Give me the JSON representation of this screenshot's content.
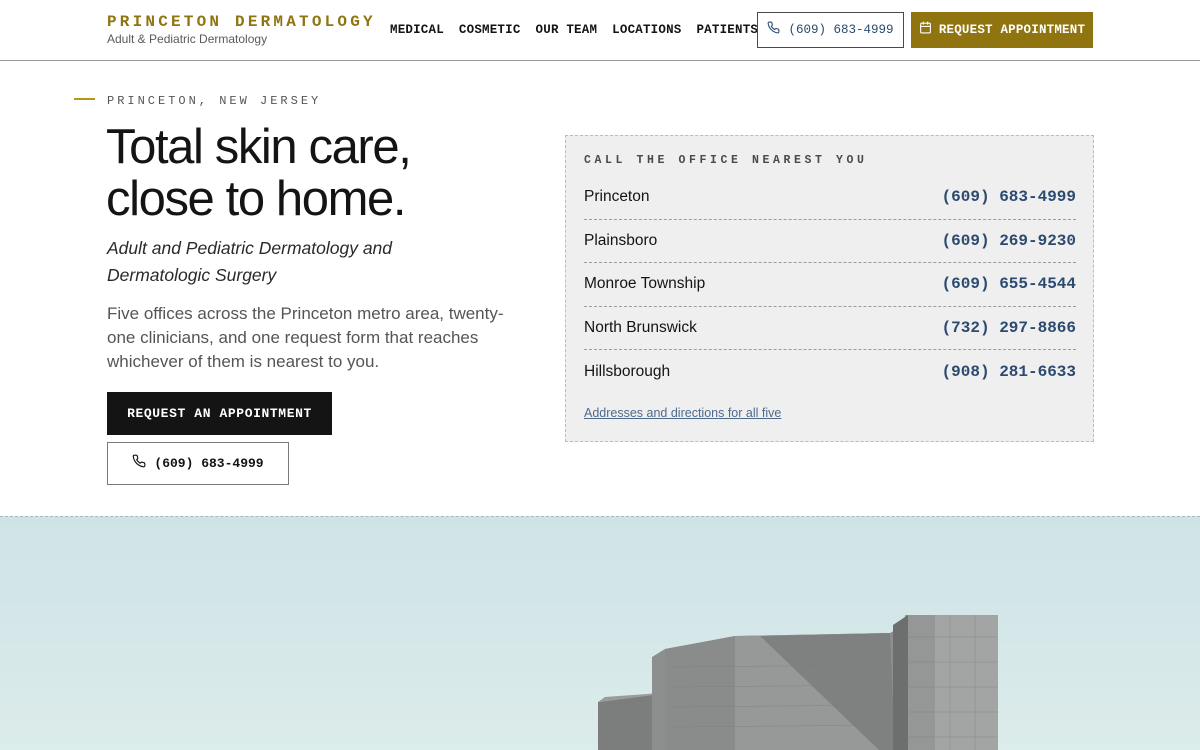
{
  "header": {
    "brand_name": "PRINCETON DERMATOLOGY",
    "brand_sub": "Adult & Pediatric Dermatology",
    "nav": [
      "MEDICAL",
      "COSMETIC",
      "OUR TEAM",
      "LOCATIONS",
      "PATIENTS"
    ],
    "phone": "(609) 683-4999",
    "cta": "REQUEST APPOINTMENT"
  },
  "hero": {
    "eyebrow": "PRINCETON, NEW JERSEY",
    "headline_line1": "Total skin care,",
    "headline_line2": "close to home.",
    "subhead_line1": "Adult and Pediatric Dermatology and",
    "subhead_line2": "Dermatologic Surgery",
    "body_line1": "Five offices across the Princeton metro area, twenty-",
    "body_line2": "one clinicians, and one request form that reaches",
    "body_line3": "whichever of them is nearest to you.",
    "primary_button": "REQUEST AN APPOINTMENT",
    "secondary_button": "(609) 683-4999"
  },
  "offices_card": {
    "title": "CALL THE OFFICE NEAREST YOU",
    "offices": [
      {
        "name": "Princeton",
        "phone": "(609) 683-4999"
      },
      {
        "name": "Plainsboro",
        "phone": "(609) 269-9230"
      },
      {
        "name": "Monroe Township",
        "phone": "(609) 655-4544"
      },
      {
        "name": "North Brunswick",
        "phone": "(732) 297-8866"
      },
      {
        "name": "Hillsborough",
        "phone": "(908) 281-6633"
      }
    ],
    "link": "Addresses and directions for all five"
  },
  "colors": {
    "brand_gold": "#8f7410",
    "phone_blue": "#2c4a70",
    "dark": "#141414",
    "sky": "#d3e6e7"
  },
  "icons": {
    "phone": "phone-icon",
    "calendar": "calendar-icon"
  }
}
